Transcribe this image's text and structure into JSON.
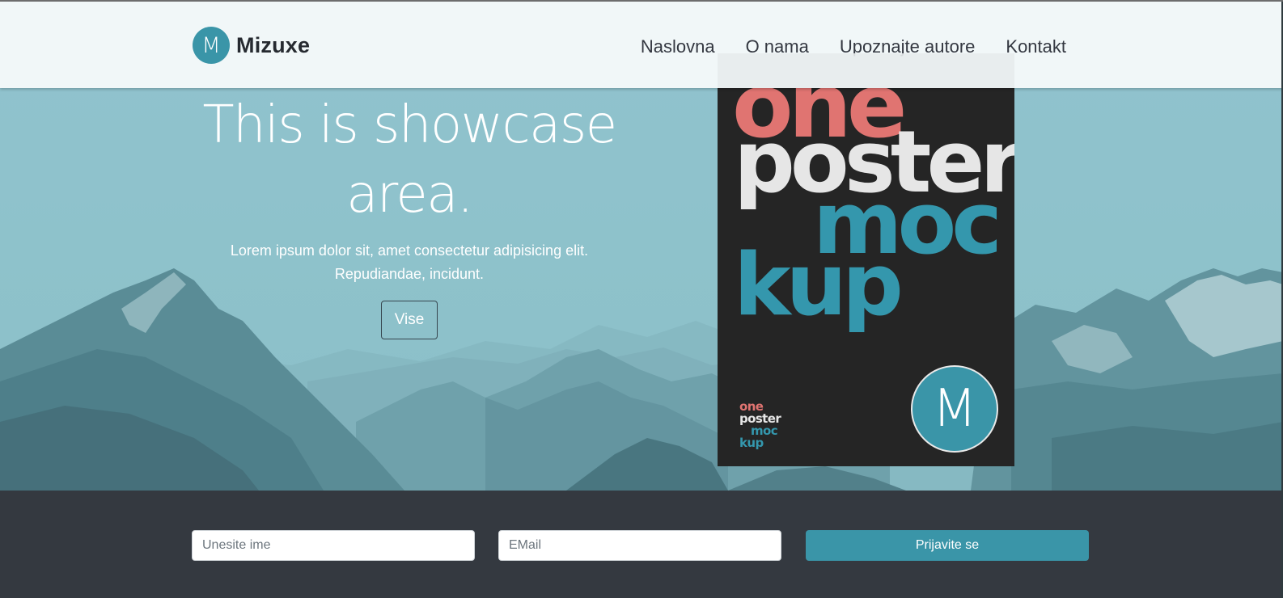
{
  "brand": {
    "logo_letter": "M",
    "name": "Mizuxe"
  },
  "nav": {
    "items": [
      "Naslovna",
      "O nama",
      "Upoznajte autore",
      "Kontakt"
    ]
  },
  "showcase": {
    "heading": "This is showcase area.",
    "text": "Lorem ipsum dolor sit, amet consectetur adipisicing elit. Repudiandae, incidunt.",
    "button_label": "Vise"
  },
  "poster": {
    "words": [
      "one",
      "poster",
      "moc",
      "kup"
    ],
    "logo_letter": "M"
  },
  "subscribe": {
    "name_placeholder": "Unesite ime",
    "email_placeholder": "EMail",
    "button_label": "Prijavite se"
  },
  "colors": {
    "accent": "#3a95a8",
    "dark": "#343940",
    "poster_bg": "#252525",
    "poster_red": "#e07471"
  }
}
